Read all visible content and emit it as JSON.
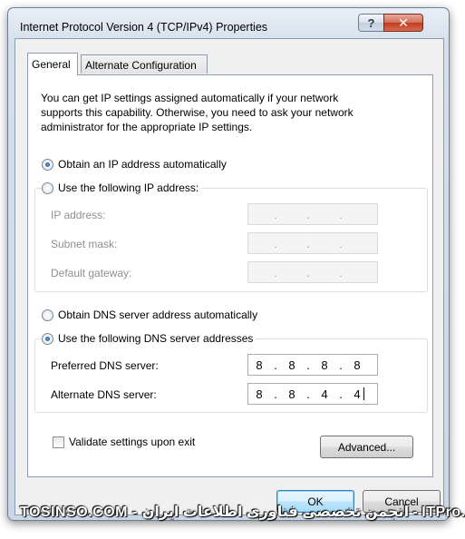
{
  "window": {
    "title": "Internet Protocol Version 4 (TCP/IPv4) Properties",
    "help_glyph": "?",
    "close_glyph": "✕"
  },
  "tabs": [
    {
      "label": "General",
      "active": true
    },
    {
      "label": "Alternate Configuration",
      "active": false
    }
  ],
  "intro_lines": [
    "You can get IP settings assigned automatically if your network",
    "supports this capability. Otherwise, you need to ask your network",
    "administrator for the appropriate IP settings."
  ],
  "ip_mode": {
    "auto_label": "Obtain an IP address automatically",
    "auto_checked": true,
    "manual_label": "Use the following IP address:",
    "manual_checked": false,
    "fields": [
      {
        "label": "IP address:",
        "octets": [
          "",
          "",
          "",
          ""
        ]
      },
      {
        "label": "Subnet mask:",
        "octets": [
          "",
          "",
          "",
          ""
        ]
      },
      {
        "label": "Default gateway:",
        "octets": [
          "",
          "",
          "",
          ""
        ]
      }
    ]
  },
  "dns_mode": {
    "auto_label": "Obtain DNS server address automatically",
    "auto_checked": false,
    "manual_label": "Use the following DNS server addresses",
    "manual_checked": true,
    "preferred": {
      "label": "Preferred DNS server:",
      "octets": [
        "8",
        "8",
        "8",
        "8"
      ]
    },
    "alternate": {
      "label": "Alternate DNS server:",
      "octets": [
        "8",
        "8",
        "4",
        "4"
      ]
    }
  },
  "validate": {
    "label": "Validate settings upon exit",
    "checked": false
  },
  "buttons": {
    "advanced": "Advanced...",
    "ok": "OK",
    "cancel": "Cancel"
  },
  "watermark": "TOSINSO.COM - انجمن تخصصی فناوری اطلاعات ایران - ITPro.ir",
  "dot": "."
}
